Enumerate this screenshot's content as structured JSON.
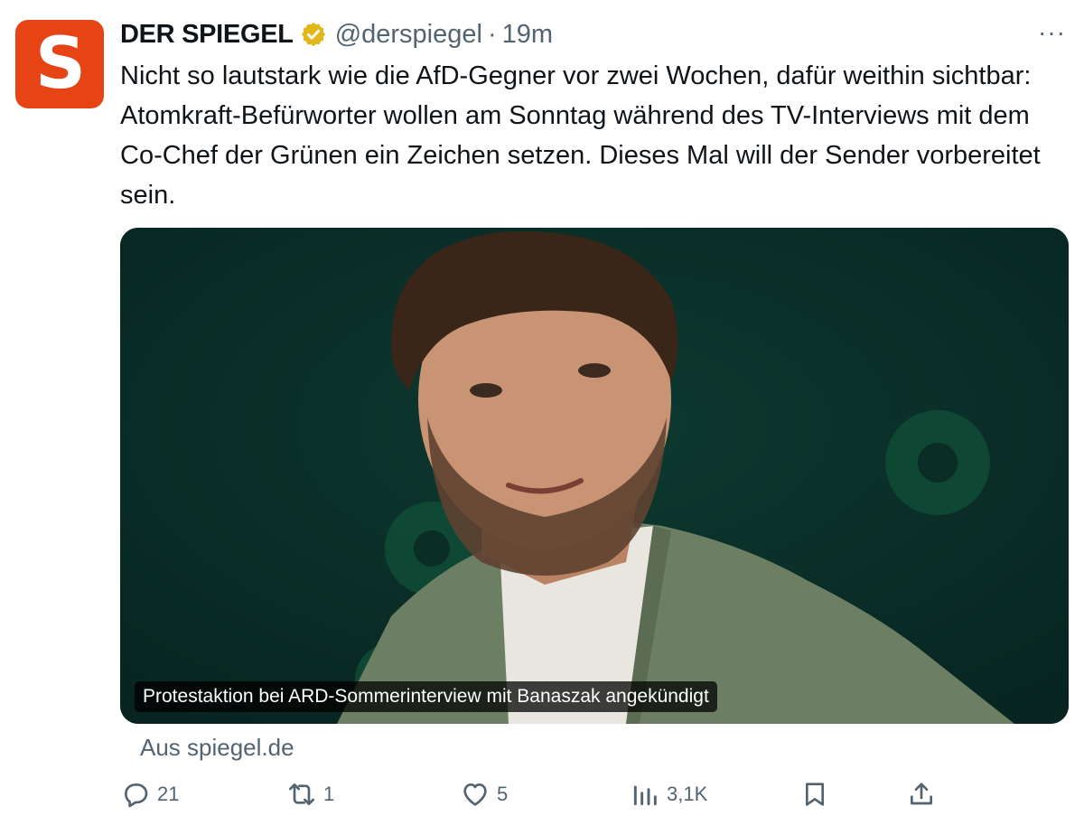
{
  "tweet": {
    "avatar_letter": "S",
    "author_name": "DER SPIEGEL",
    "handle": "@derspiegel",
    "separator": "·",
    "time": "19m",
    "more": "···",
    "text": "Nicht so lautstark wie die AfD-Gegner vor zwei Wochen, dafür weithin sichtbar: Atomkraft-Befürworter wollen am Sonntag während des TV-Interviews mit dem Co-Chef der Grünen ein Zeichen setzen. Dieses Mal will der Sender vorbereitet sein.",
    "card": {
      "caption": "Protestaktion bei ARD-Sommerinterview mit Banaszak angekündigt",
      "source": "Aus spiegel.de"
    },
    "actions": {
      "replies": "21",
      "retweets": "1",
      "likes": "5",
      "views": "3,1K"
    }
  },
  "icons": {
    "verified": "verified-badge-icon",
    "reply": "reply-icon",
    "retweet": "retweet-icon",
    "like": "heart-icon",
    "views": "views-icon",
    "bookmark": "bookmark-icon",
    "share": "share-icon"
  },
  "colors": {
    "brand": "#e64415",
    "verified": "#e2b719",
    "text": "#0f1419",
    "secondary": "#536471",
    "media_background": "#0a2d25"
  }
}
